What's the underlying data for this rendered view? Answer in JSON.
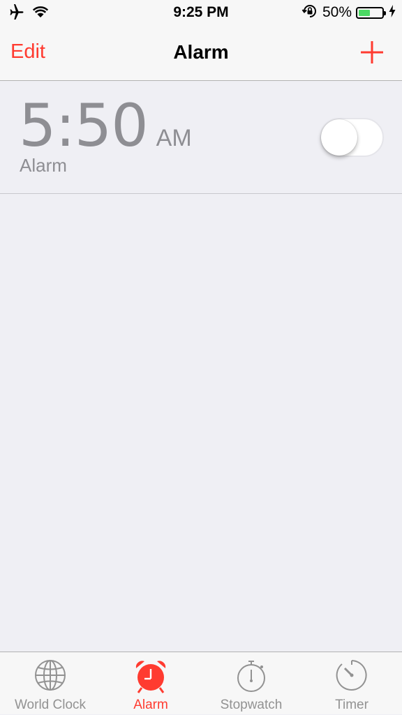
{
  "status_bar": {
    "time": "9:25 PM",
    "battery_percent_label": "50%",
    "battery_level": 0.5,
    "icons": [
      "airplane-icon",
      "wifi-icon",
      "rotation-lock-icon",
      "battery-icon",
      "charging-bolt-icon"
    ]
  },
  "nav": {
    "edit_label": "Edit",
    "title": "Alarm",
    "add_icon": "plus-icon"
  },
  "alarms": [
    {
      "time": "5:50",
      "ampm": "AM",
      "label": "Alarm",
      "enabled": false
    }
  ],
  "tabs": [
    {
      "label": "World Clock",
      "icon": "globe-icon",
      "active": false
    },
    {
      "label": "Alarm",
      "icon": "alarm-clock-icon",
      "active": true
    },
    {
      "label": "Stopwatch",
      "icon": "stopwatch-icon",
      "active": false
    },
    {
      "label": "Timer",
      "icon": "timer-icon",
      "active": false
    }
  ],
  "colors": {
    "accent": "#ff3b30",
    "background": "#efeff4",
    "bar_background": "#f7f7f7",
    "inactive_text": "#8e8e93",
    "battery_fill": "#4cd964"
  }
}
